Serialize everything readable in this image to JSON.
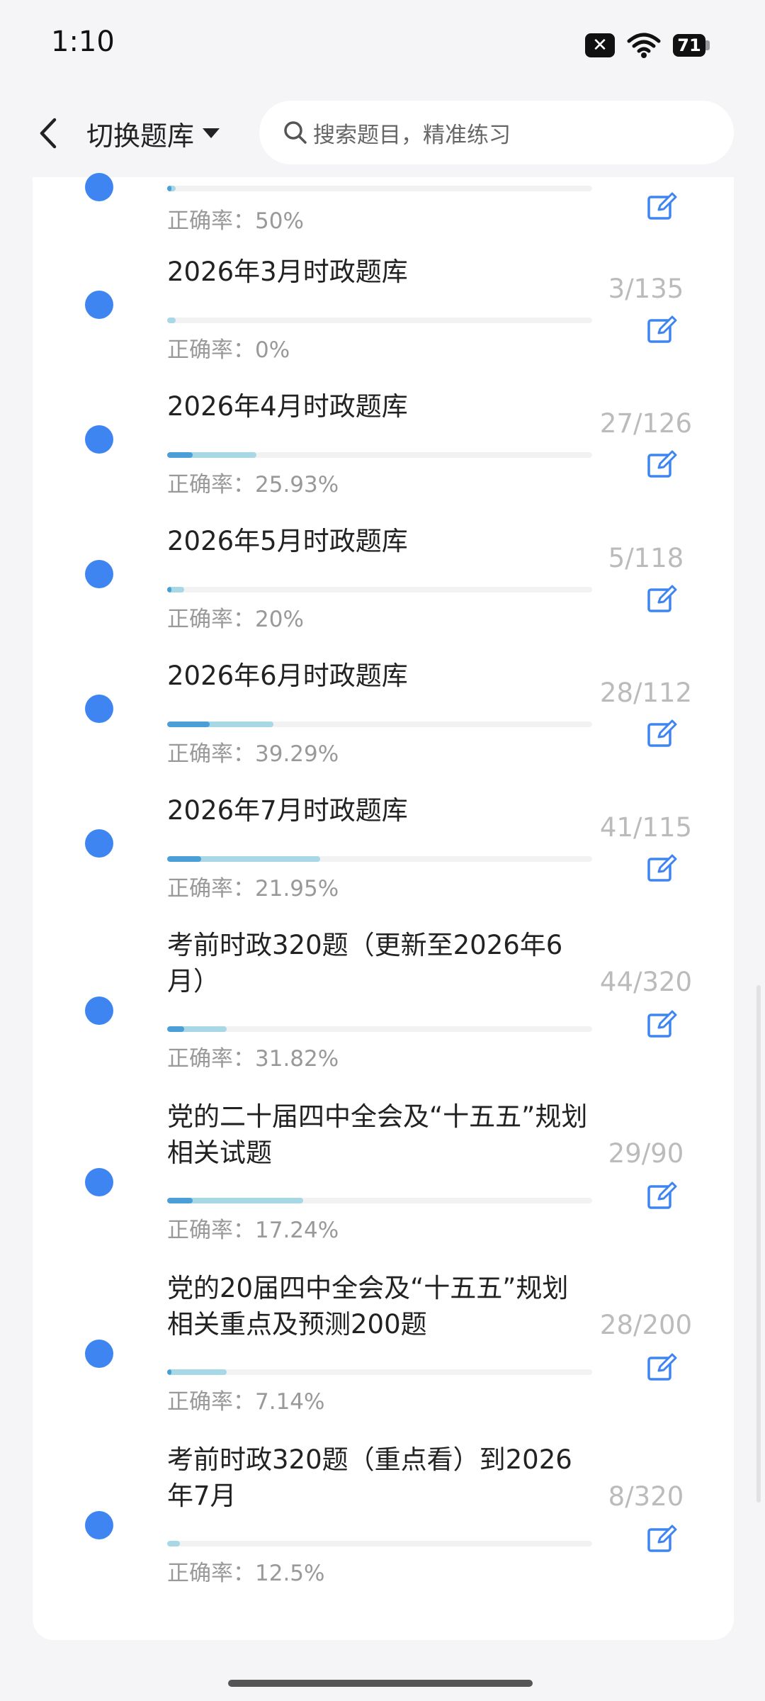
{
  "status_bar": {
    "time": "1:10",
    "battery": "71",
    "sim_badge": "✕"
  },
  "nav": {
    "switch_label": "切换题库",
    "search_placeholder": "搜索题目，精准练习"
  },
  "items": [
    {
      "title": "",
      "rate": "正确率：50%",
      "count": "",
      "progress": 0.02,
      "correct": 0.01
    },
    {
      "title": "2026年3月时政题库",
      "rate": "正确率：0%",
      "count": "3/135",
      "progress": 0.02,
      "correct": 0.0
    },
    {
      "title": "2026年4月时政题库",
      "rate": "正确率：25.93%",
      "count": "27/126",
      "progress": 0.21,
      "correct": 0.06
    },
    {
      "title": "2026年5月时政题库",
      "rate": "正确率：20%",
      "count": "5/118",
      "progress": 0.04,
      "correct": 0.01
    },
    {
      "title": "2026年6月时政题库",
      "rate": "正确率：39.29%",
      "count": "28/112",
      "progress": 0.25,
      "correct": 0.1
    },
    {
      "title": "2026年7月时政题库",
      "rate": "正确率：21.95%",
      "count": "41/115",
      "progress": 0.36,
      "correct": 0.08
    },
    {
      "title": "考前时政320题（更新至2026年6月）",
      "rate": "正确率：31.82%",
      "count": "44/320",
      "progress": 0.14,
      "correct": 0.04
    },
    {
      "title": "党的二十届四中全会及“十五五”规划相关试题",
      "rate": "正确率：17.24%",
      "count": "29/90",
      "progress": 0.32,
      "correct": 0.06
    },
    {
      "title": "党的20届四中全会及“十五五”规划相关重点及预测200题",
      "rate": "正确率：7.14%",
      "count": "28/200",
      "progress": 0.14,
      "correct": 0.01
    },
    {
      "title": "考前时政320题（重点看）到2026年7月",
      "rate": "正确率：12.5%",
      "count": "8/320",
      "progress": 0.03,
      "correct": 0.0
    }
  ],
  "colors": {
    "accent": "#3e85f1",
    "progress_correct": "#4a9fd6",
    "progress_done": "#a8d7e5",
    "muted_text": "#999999"
  },
  "icons": {
    "back": "chevron-left-icon",
    "dropdown": "caret-down-icon",
    "search": "search-icon",
    "edit": "edit-icon",
    "wifi": "wifi-icon",
    "battery": "battery-icon"
  }
}
